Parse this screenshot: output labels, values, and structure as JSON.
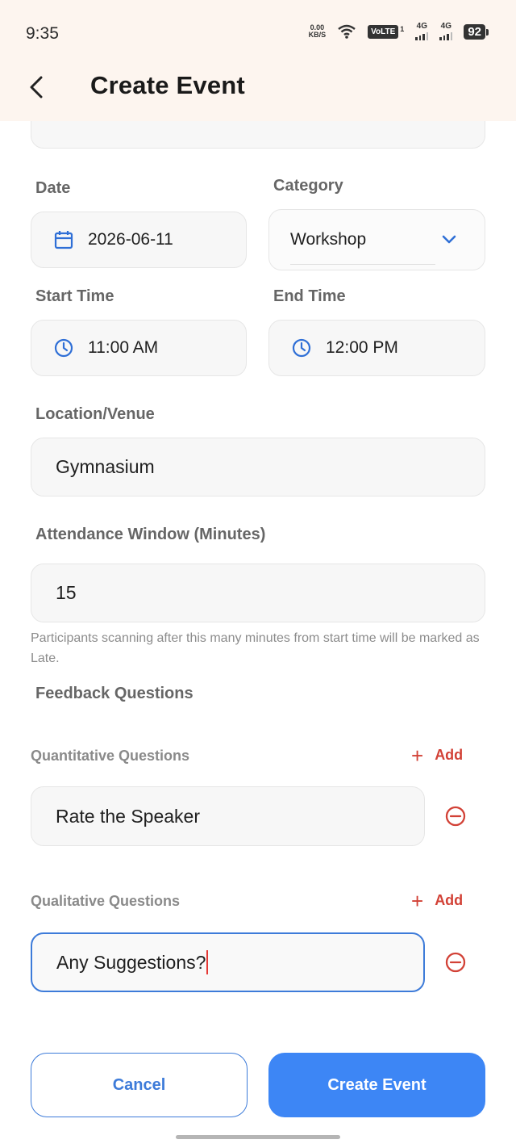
{
  "status_bar": {
    "time": "9:35",
    "net_speed_value": "0.00",
    "net_speed_unit": "KB/S",
    "volte": "VoLTE",
    "sim1_label": "4G",
    "sim2_label": "4G",
    "sim_slot": "1",
    "battery": "92"
  },
  "app_bar": {
    "title": "Create Event"
  },
  "form": {
    "date": {
      "label": "Date",
      "value": "2026-06-11"
    },
    "category": {
      "label": "Category",
      "value": "Workshop"
    },
    "start_time": {
      "label": "Start Time",
      "value": "11:00 AM"
    },
    "end_time": {
      "label": "End Time",
      "value": "12:00 PM"
    },
    "location": {
      "label": "Location/Venue",
      "value": "Gymnasium"
    },
    "attendance_window": {
      "label": "Attendance Window (Minutes)",
      "value": "15",
      "helper": "Participants scanning after this many minutes from start time will be marked as Late."
    },
    "feedback": {
      "heading": "Feedback Questions",
      "quantitative": {
        "label": "Quantitative Questions",
        "add_label": "Add",
        "questions": [
          "Rate the Speaker"
        ]
      },
      "qualitative": {
        "label": "Qualitative Questions",
        "add_label": "Add",
        "questions": [
          "Any Suggestions?"
        ]
      }
    }
  },
  "actions": {
    "cancel_label": "Cancel",
    "create_label": "Create Event"
  },
  "colors": {
    "accent": "#3d86f5",
    "danger": "#d24136",
    "icon": "#2f6fd6",
    "app_bar_bg": "#fdf5ef"
  }
}
